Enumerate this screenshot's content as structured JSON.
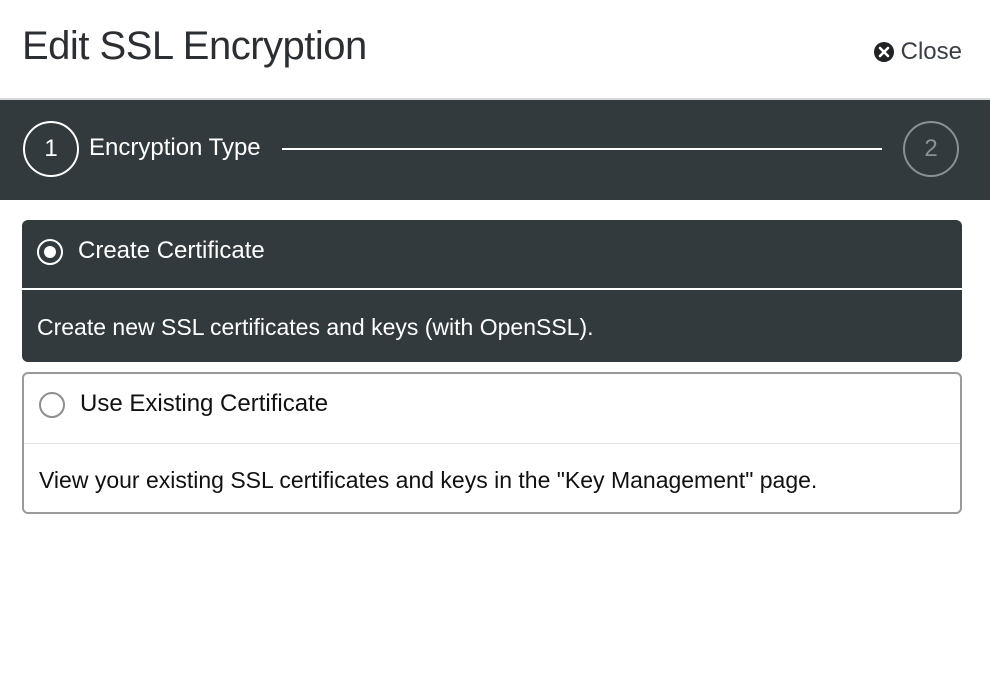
{
  "dialog": {
    "title": "Edit SSL Encryption",
    "close_label": "Close"
  },
  "stepper": {
    "steps": [
      {
        "number": "1",
        "label": "Encryption Type"
      },
      {
        "number": "2",
        "label": ""
      }
    ],
    "current_step": 1
  },
  "options": [
    {
      "title": "Create Certificate",
      "description": "Create new SSL certificates and keys (with OpenSSL).",
      "selected": true
    },
    {
      "title": "Use Existing Certificate",
      "description": "View your existing SSL certificates and keys in the \"Key Management\" page.",
      "selected": false
    }
  ],
  "colors": {
    "dark_bar": "#323a3e",
    "border": "#9a9a9a"
  },
  "icons": {
    "close": "close-circle-x-icon"
  }
}
